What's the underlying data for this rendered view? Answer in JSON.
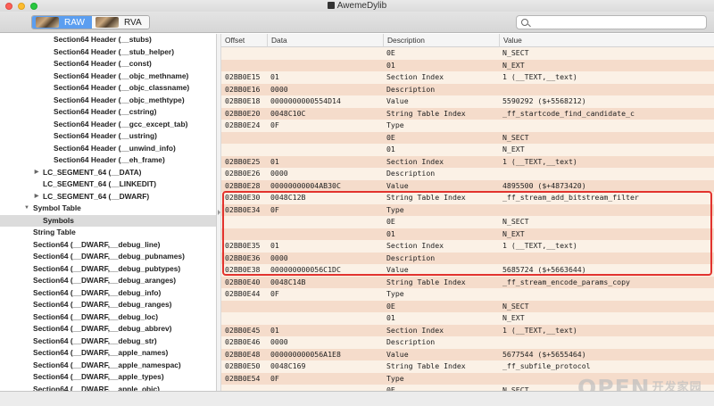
{
  "window": {
    "title": "AwemeDylib"
  },
  "toolbar": {
    "modes": [
      {
        "label": "RAW",
        "active": true
      },
      {
        "label": "RVA",
        "active": false
      }
    ],
    "search_placeholder": ""
  },
  "sidebar": {
    "items": [
      {
        "label": "Section64 Header (__stubs)",
        "indent": 60,
        "disclosure": ""
      },
      {
        "label": "Section64 Header (__stub_helper)",
        "indent": 60,
        "disclosure": ""
      },
      {
        "label": "Section64 Header (__const)",
        "indent": 60,
        "disclosure": ""
      },
      {
        "label": "Section64 Header (__objc_methname)",
        "indent": 60,
        "disclosure": ""
      },
      {
        "label": "Section64 Header (__objc_classname)",
        "indent": 60,
        "disclosure": ""
      },
      {
        "label": "Section64 Header (__objc_methtype)",
        "indent": 60,
        "disclosure": ""
      },
      {
        "label": "Section64 Header (__cstring)",
        "indent": 60,
        "disclosure": ""
      },
      {
        "label": "Section64 Header (__gcc_except_tab)",
        "indent": 60,
        "disclosure": ""
      },
      {
        "label": "Section64 Header (__ustring)",
        "indent": 60,
        "disclosure": ""
      },
      {
        "label": "Section64 Header (__unwind_info)",
        "indent": 60,
        "disclosure": ""
      },
      {
        "label": "Section64 Header (__eh_frame)",
        "indent": 60,
        "disclosure": ""
      },
      {
        "label": "LC_SEGMENT_64 (__DATA)",
        "indent": 48,
        "disclosure": "collapsed"
      },
      {
        "label": "LC_SEGMENT_64 (__LINKEDIT)",
        "indent": 48,
        "disclosure": ""
      },
      {
        "label": "LC_SEGMENT_64 (__DWARF)",
        "indent": 48,
        "disclosure": "collapsed"
      },
      {
        "label": "Symbol Table",
        "indent": 37,
        "disclosure": "expanded"
      },
      {
        "label": "Symbols",
        "indent": 48,
        "disclosure": "",
        "selected": true
      },
      {
        "label": "String Table",
        "indent": 37,
        "disclosure": ""
      },
      {
        "label": "Section64 (__DWARF,__debug_line)",
        "indent": 37,
        "disclosure": ""
      },
      {
        "label": "Section64 (__DWARF,__debug_pubnames)",
        "indent": 37,
        "disclosure": ""
      },
      {
        "label": "Section64 (__DWARF,__debug_pubtypes)",
        "indent": 37,
        "disclosure": ""
      },
      {
        "label": "Section64 (__DWARF,__debug_aranges)",
        "indent": 37,
        "disclosure": ""
      },
      {
        "label": "Section64 (__DWARF,__debug_info)",
        "indent": 37,
        "disclosure": ""
      },
      {
        "label": "Section64 (__DWARF,__debug_ranges)",
        "indent": 37,
        "disclosure": ""
      },
      {
        "label": "Section64 (__DWARF,__debug_loc)",
        "indent": 37,
        "disclosure": ""
      },
      {
        "label": "Section64 (__DWARF,__debug_abbrev)",
        "indent": 37,
        "disclosure": ""
      },
      {
        "label": "Section64 (__DWARF,__debug_str)",
        "indent": 37,
        "disclosure": ""
      },
      {
        "label": "Section64 (__DWARF,__apple_names)",
        "indent": 37,
        "disclosure": ""
      },
      {
        "label": "Section64 (__DWARF,__apple_namespac)",
        "indent": 37,
        "disclosure": ""
      },
      {
        "label": "Section64 (__DWARF,__apple_types)",
        "indent": 37,
        "disclosure": ""
      },
      {
        "label": "Section64 (__DWARF,__apple_objc)",
        "indent": 37,
        "disclosure": ""
      }
    ]
  },
  "table": {
    "columns": [
      "Offset",
      "Data",
      "Description",
      "Value"
    ],
    "rows": [
      [
        "",
        "",
        "0E",
        "N_SECT"
      ],
      [
        "",
        "",
        "01",
        "N_EXT"
      ],
      [
        "02BB0E15",
        "01",
        "Section Index",
        "1 (__TEXT,__text)"
      ],
      [
        "02BB0E16",
        "0000",
        "Description",
        ""
      ],
      [
        "02BB0E18",
        "0000000000554D14",
        "Value",
        "5590292 ($+5568212)"
      ],
      [
        "02BB0E20",
        "0048C10C",
        "String Table Index",
        "_ff_startcode_find_candidate_c"
      ],
      [
        "02BB0E24",
        "0F",
        "Type",
        ""
      ],
      [
        "",
        "",
        "0E",
        "N_SECT"
      ],
      [
        "",
        "",
        "01",
        "N_EXT"
      ],
      [
        "02BB0E25",
        "01",
        "Section Index",
        "1 (__TEXT,__text)"
      ],
      [
        "02BB0E26",
        "0000",
        "Description",
        ""
      ],
      [
        "02BB0E28",
        "00000000004AB30C",
        "Value",
        "4895500 ($+4873420)"
      ],
      [
        "02BB0E30",
        "0048C12B",
        "String Table Index",
        "_ff_stream_add_bitstream_filter"
      ],
      [
        "02BB0E34",
        "0F",
        "Type",
        ""
      ],
      [
        "",
        "",
        "0E",
        "N_SECT"
      ],
      [
        "",
        "",
        "01",
        "N_EXT"
      ],
      [
        "02BB0E35",
        "01",
        "Section Index",
        "1 (__TEXT,__text)"
      ],
      [
        "02BB0E36",
        "0000",
        "Description",
        ""
      ],
      [
        "02BB0E38",
        "000000000056C1DC",
        "Value",
        "5685724 ($+5663644)"
      ],
      [
        "02BB0E40",
        "0048C14B",
        "String Table Index",
        "_ff_stream_encode_params_copy"
      ],
      [
        "02BB0E44",
        "0F",
        "Type",
        ""
      ],
      [
        "",
        "",
        "0E",
        "N_SECT"
      ],
      [
        "",
        "",
        "01",
        "N_EXT"
      ],
      [
        "02BB0E45",
        "01",
        "Section Index",
        "1 (__TEXT,__text)"
      ],
      [
        "02BB0E46",
        "0000",
        "Description",
        ""
      ],
      [
        "02BB0E48",
        "000000000056A1E8",
        "Value",
        "5677544 ($+5655464)"
      ],
      [
        "02BB0E50",
        "0048C169",
        "String Table Index",
        "_ff_subfile_protocol"
      ],
      [
        "02BB0E54",
        "0F",
        "Type",
        ""
      ],
      [
        "",
        "",
        "0E",
        "N_SECT"
      ]
    ]
  },
  "watermark": {
    "text": "OPEN",
    "suffix": "开发家园"
  },
  "colors": {
    "row_odd": "#fbf1e6",
    "row_even": "#f5dccb",
    "highlight": "#e2332e",
    "accent": "#5b9ef0"
  }
}
